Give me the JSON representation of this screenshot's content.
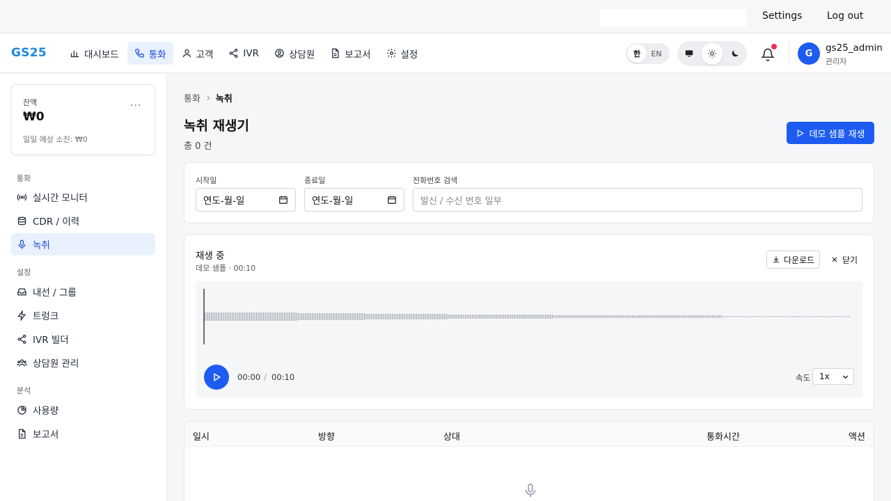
{
  "topbar": {
    "settings_label": "Settings",
    "logout_label": "Log out"
  },
  "header": {
    "logo": "GS25",
    "nav": [
      {
        "label": "대시보드",
        "icon": "bar-chart-icon"
      },
      {
        "label": "통화",
        "icon": "phone-icon",
        "active": true
      },
      {
        "label": "고객",
        "icon": "user-icon"
      },
      {
        "label": "IVR",
        "icon": "share-icon"
      },
      {
        "label": "상담원",
        "icon": "user-circle-icon"
      },
      {
        "label": "보고서",
        "icon": "document-icon"
      },
      {
        "label": "설정",
        "icon": "gear-icon"
      }
    ],
    "lang": {
      "ko": "한",
      "en": "EN",
      "selected": "ko"
    },
    "theme": {
      "selected": "light"
    },
    "user": {
      "avatar": "G",
      "name": "gs25_admin",
      "role": "관리자"
    }
  },
  "sidebar": {
    "balance": {
      "label": "잔액",
      "value": "₩0",
      "more": "···",
      "sub": "일일 예상 소진: ₩0"
    },
    "sections": [
      {
        "title": "통화",
        "items": [
          {
            "label": "실시간 모니터",
            "icon": "broadcast-icon"
          },
          {
            "label": "CDR / 이력",
            "icon": "list-icon"
          },
          {
            "label": "녹취",
            "icon": "microphone-icon",
            "active": true
          }
        ]
      },
      {
        "title": "설정",
        "items": [
          {
            "label": "내선 / 그룹",
            "icon": "inbox-icon"
          },
          {
            "label": "트렁크",
            "icon": "lightning-icon"
          },
          {
            "label": "IVR 빌더",
            "icon": "share-icon"
          },
          {
            "label": "상담원 관리",
            "icon": "users-icon"
          }
        ]
      },
      {
        "title": "분석",
        "items": [
          {
            "label": "사용량",
            "icon": "pie-chart-icon"
          },
          {
            "label": "보고서",
            "icon": "document-icon"
          }
        ]
      }
    ]
  },
  "main": {
    "breadcrumb": [
      "통화",
      "녹취"
    ],
    "title": "녹취 재생기",
    "count": "총 0 건",
    "demo_button": "데모 샘플 재생",
    "filters": {
      "start_label": "시작일",
      "start_value": "연도-월-일",
      "end_label": "종료일",
      "end_value": "연도-월-일",
      "phone_label": "전화번호 검색",
      "phone_placeholder": "발신 / 수신 번호 일부"
    },
    "player": {
      "title": "재생 중",
      "subtitle": "데모 샘플 · 00:10",
      "download": "다운로드",
      "close": "닫기",
      "current_time": "00:00",
      "separator": "/",
      "total_time": "00:10",
      "progress": 0,
      "speed_label": "속도",
      "speed_value": "1x"
    },
    "table": {
      "columns": [
        "일시",
        "방향",
        "상대",
        "통화시간",
        "액션"
      ]
    }
  },
  "colors": {
    "primary": "#1d5bf1",
    "active_bg": "#eaf1fe",
    "logo": "#1e88d8",
    "notify": "#ef2b55"
  }
}
